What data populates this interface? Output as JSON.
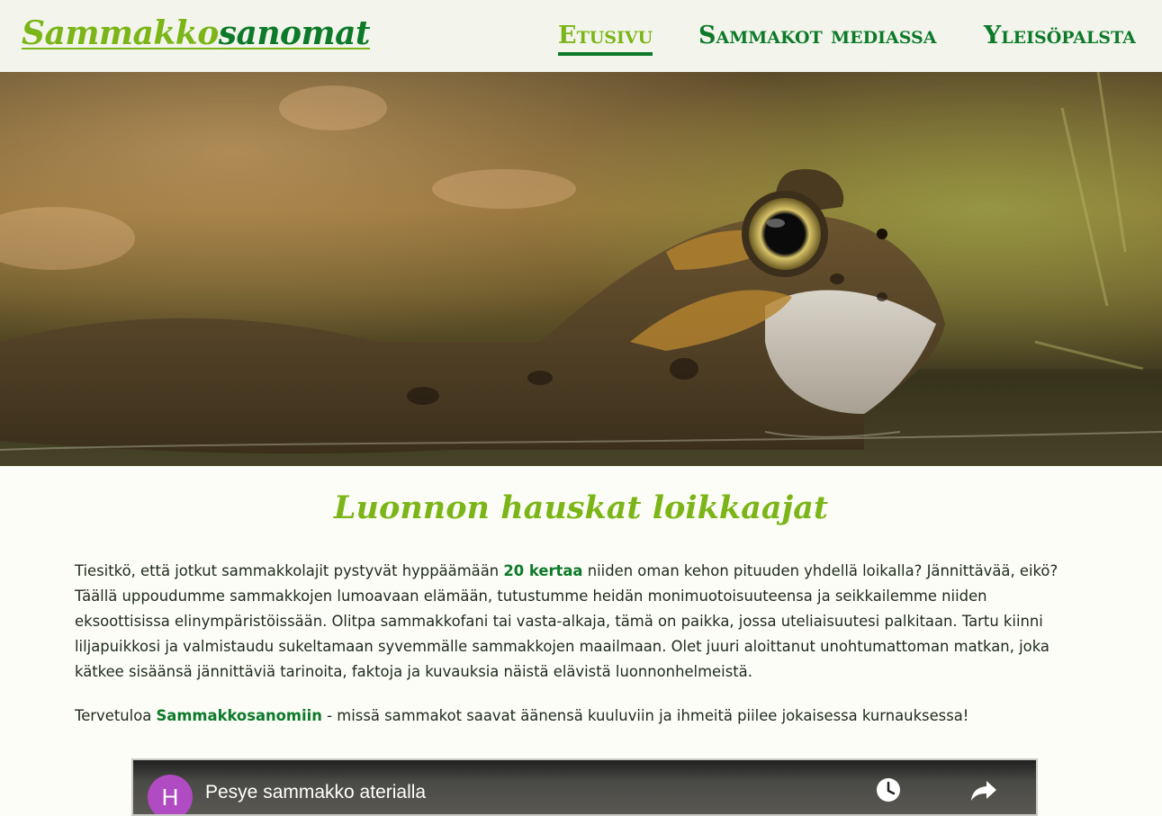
{
  "header": {
    "logo_part1": "Sammakko",
    "logo_part2": "sanomat",
    "nav": [
      {
        "label": "Etusivu",
        "active": true
      },
      {
        "label": "Sammakot mediassa",
        "active": false
      },
      {
        "label": "Yleisöpalsta",
        "active": false
      }
    ]
  },
  "hero": {
    "icon": "frog-photo"
  },
  "main": {
    "title": "Luonnon hauskat loikkaajat",
    "p1_before": "Tiesitkö, että jotkut sammakkolajit pystyvät hyppäämään ",
    "p1_highlight": "20 kertaa",
    "p1_after": " niiden oman kehon pituuden yhdellä loikalla? Jännittävää, eikö? Täällä uppoudumme sammakkojen lumoavaan elämään, tutustumme heidän monimuotoisuuteensa ja seikkailemme niiden eksoottisissa elinympäristöissään. Olitpa sammakkofani tai vasta-alkaja, tämä on paikka, jossa uteliaisuutesi palkitaan. Tartu kiinni liljapuikkosi ja valmistaudu sukeltamaan syvemmälle sammakkojen maailmaan. Olet juuri aloittanut unohtumattoman matkan, joka kätkee sisäänsä jännittäviä tarinoita, faktoja ja kuvauksia näistä elävistä luonnonhelmeistä.",
    "p2_before": "Tervetuloa ",
    "p2_highlight": "Sammakkosanomiin",
    "p2_after": " - missä sammakot saavat äänensä kuuluviin ja ihmeitä piilee jokaisessa kurnauksessa!"
  },
  "video": {
    "avatar_letter": "H",
    "title": "Pesye sammakko aterialla",
    "icons": [
      "clock-icon",
      "share-icon"
    ]
  },
  "colors": {
    "brand_light": "#7cb518",
    "brand_dark": "#0d7a2a",
    "header_bg": "#f3f5ec",
    "page_bg": "#fcfdf6"
  }
}
